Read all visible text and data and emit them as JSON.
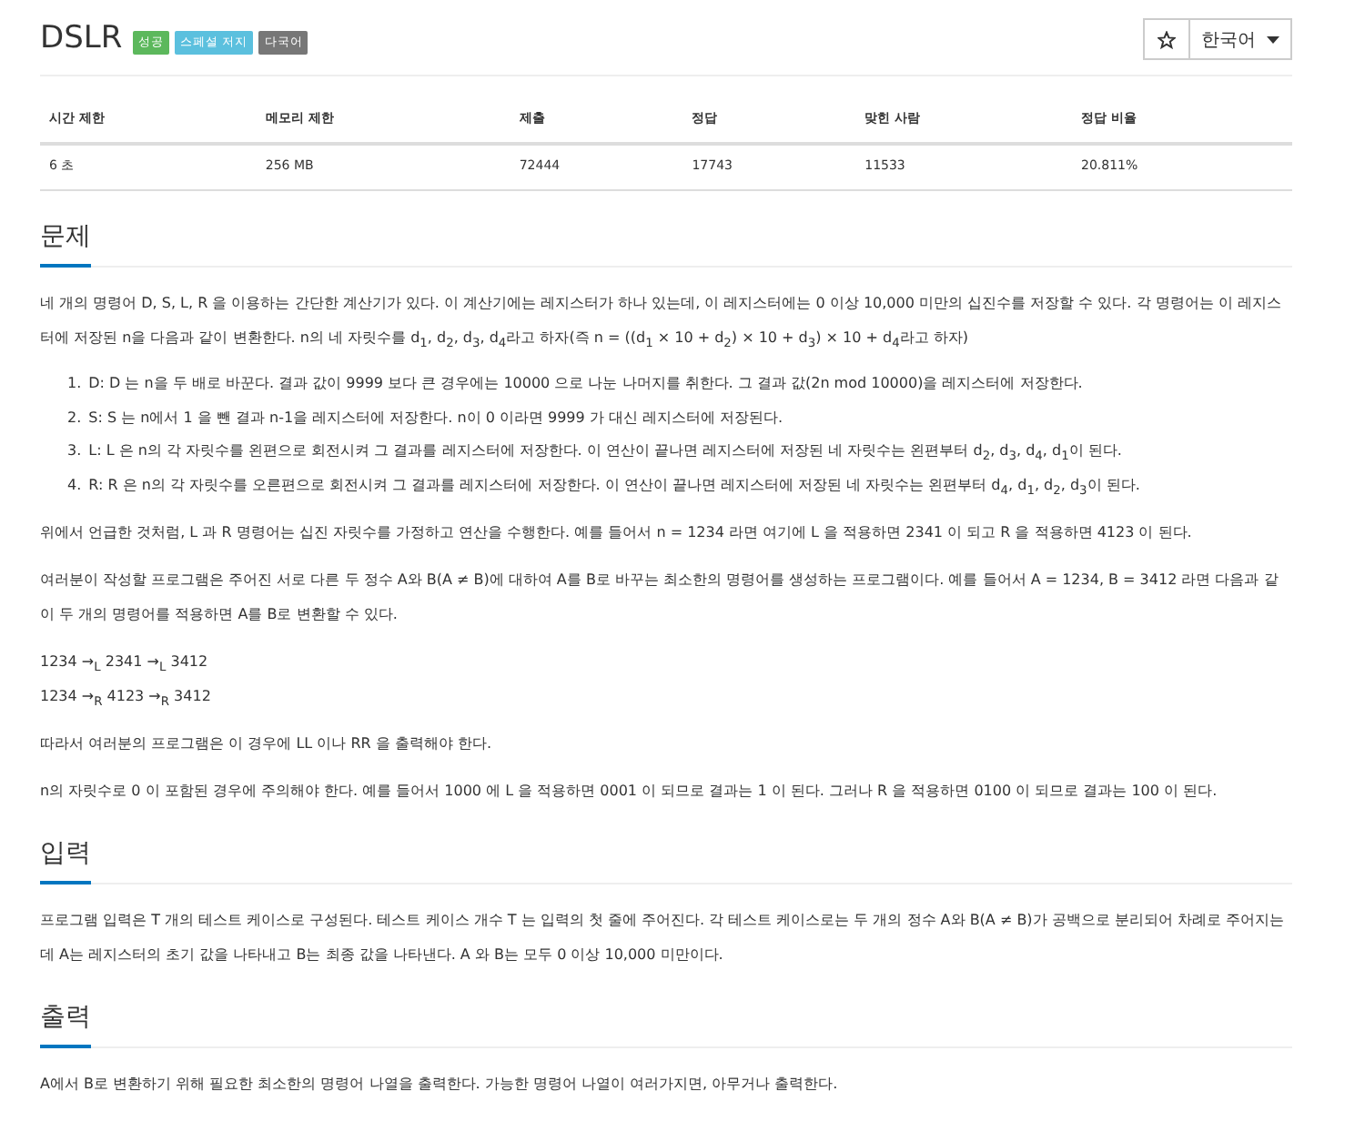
{
  "title": "DSLR",
  "badges": [
    {
      "label": "성공",
      "color": "#5cb85c"
    },
    {
      "label": "스페셜 저지",
      "color": "#5bc0de"
    },
    {
      "label": "다국어",
      "color": "#777777"
    }
  ],
  "language": {
    "label": "한국어"
  },
  "stats": {
    "columns": [
      "시간 제한",
      "메모리 제한",
      "제출",
      "정답",
      "맞힌 사람",
      "정답 비율"
    ],
    "values": [
      "6 초",
      "256 MB",
      "72444",
      "17743",
      "11533",
      "20.811%"
    ]
  },
  "sections": [
    {
      "heading": "문제",
      "blocks": [
        {
          "kind": "p",
          "text": "네 개의 명령어 D, S, L, R 을 이용하는 간단한 계산기가 있다. 이 계산기에는 레지스터가 하나 있는데, 이 레지스터에는 0 이상 10,000 미만의 십진수를 저장할 수 있다. 각 명령어는 이 레지스터에 저장된 n을 다음과 같이 변환한다. n의 네 자릿수를 d$_{1}$, d$_{2}$, d$_{3}$, d$_{4}$라고 하자(즉 n = ((d$_{1}$ × 10 + d$_{2}$) × 10 + d$_{3}$) × 10 + d$_{4}$라고 하자)"
        },
        {
          "kind": "ol",
          "items": [
            {
              "number": "1.",
              "text": "D: D 는 n을 두 배로 바꾼다. 결과 값이 9999 보다 큰 경우에는 10000 으로 나눈 나머지를 취한다. 그 결과 값(2n mod 10000)을 레지스터에 저장한다."
            },
            {
              "number": "2.",
              "text": "S: S 는 n에서 1 을 뺀 결과 n-1을 레지스터에 저장한다. n이 0 이라면 9999 가 대신 레지스터에 저장된다."
            },
            {
              "number": "3.",
              "text": "L: L 은 n의 각 자릿수를 왼편으로 회전시켜 그 결과를 레지스터에 저장한다. 이 연산이 끝나면 레지스터에 저장된 네 자릿수는 왼편부터 d$_{2}$, d$_{3}$, d$_{4}$, d$_{1}$이 된다."
            },
            {
              "number": "4.",
              "text": "R: R 은 n의 각 자릿수를 오른편으로 회전시켜 그 결과를 레지스터에 저장한다. 이 연산이 끝나면 레지스터에 저장된 네 자릿수는 왼편부터 d$_{4}$, d$_{1}$, d$_{2}$, d$_{3}$이 된다."
            }
          ]
        },
        {
          "kind": "p",
          "text": "위에서 언급한 것처럼, L 과 R 명령어는 십진 자릿수를 가정하고 연산을 수행한다. 예를 들어서 n = 1234 라면 여기에 L 을 적용하면 2341 이 되고 R 을 적용하면 4123 이 된다."
        },
        {
          "kind": "p",
          "text": "여러분이 작성할 프로그램은 주어진 서로 다른 두 정수 A와 B(A ≠ B)에 대하여 A를 B로 바꾸는 최소한의 명령어를 생성하는 프로그램이다. 예를 들어서 A = 1234, B = 3412 라면 다음과 같이 두 개의 명령어를 적용하면 A를 B로 변환할 수 있다."
        },
        {
          "kind": "lines",
          "lines": [
            "1234 →$_{L}$ 2341 →$_{L}$ 3412",
            "1234 →$_{R}$ 4123 →$_{R}$ 3412"
          ]
        },
        {
          "kind": "p",
          "text": "따라서 여러분의 프로그램은 이 경우에 LL 이나 RR 을 출력해야 한다."
        },
        {
          "kind": "p",
          "text": "n의 자릿수로 0 이 포함된 경우에 주의해야 한다. 예를 들어서 1000 에 L 을 적용하면 0001 이 되므로 결과는 1 이 된다. 그러나 R 을 적용하면 0100 이 되므로 결과는 100 이 된다."
        }
      ]
    },
    {
      "heading": "입력",
      "blocks": [
        {
          "kind": "p",
          "text": "프로그램 입력은 T 개의 테스트 케이스로 구성된다. 테스트 케이스 개수 T 는 입력의 첫 줄에 주어진다. 각 테스트 케이스로는 두 개의 정수 A와 B(A ≠ B)가 공백으로 분리되어 차례로 주어지는데 A는 레지스터의 초기 값을 나타내고 B는 최종 값을 나타낸다. A 와 B는 모두 0 이상 10,000 미만이다."
        }
      ]
    },
    {
      "heading": "출력",
      "blocks": [
        {
          "kind": "p",
          "text": "A에서 B로 변환하기 위해 필요한 최소한의 명령어 나열을 출력한다. 가능한 명령어 나열이 여러가지면, 아무거나 출력한다."
        }
      ]
    }
  ]
}
